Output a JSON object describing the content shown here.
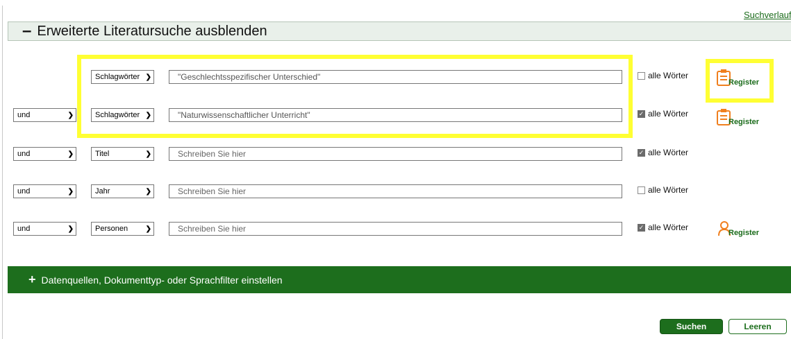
{
  "top_link": "Suchverlauf",
  "header": {
    "toggle_symbol": "–",
    "title": "Erweiterte Literatursuche ausblenden"
  },
  "rows": [
    {
      "operator": "",
      "field": "Schlagwörter",
      "value": "\"Geschlechtsspezifischer Unterschied\"",
      "all_words_label": "alle Wörter",
      "all_words_checked": false,
      "register": "Register",
      "register_icon": "clipboard-icon"
    },
    {
      "operator": "und",
      "field": "Schlagwörter",
      "value": "\"Naturwissenschaftlicher Unterricht\"",
      "all_words_label": "alle Wörter",
      "all_words_checked": true,
      "register": "Register",
      "register_icon": "clipboard-icon"
    },
    {
      "operator": "und",
      "field": "Titel",
      "placeholder": "Schreiben Sie hier",
      "all_words_label": "alle Wörter",
      "all_words_checked": true
    },
    {
      "operator": "und",
      "field": "Jahr",
      "placeholder": "Schreiben Sie hier",
      "all_words_label": "alle Wörter",
      "all_words_checked": false
    },
    {
      "operator": "und",
      "field": "Personen",
      "placeholder": "Schreiben Sie hier",
      "all_words_label": "alle Wörter",
      "all_words_checked": true,
      "register": "Register",
      "register_icon": "person-icon"
    }
  ],
  "filter_bar": {
    "symbol": "+",
    "label": "Datenquellen, Dokumenttyp- oder Sprachfilter einstellen"
  },
  "buttons": {
    "search": "Suchen",
    "clear": "Leeren"
  },
  "colors": {
    "brand_green": "#1d6e1d",
    "highlight": "#ffff33",
    "register_orange": "#f07f1e"
  }
}
